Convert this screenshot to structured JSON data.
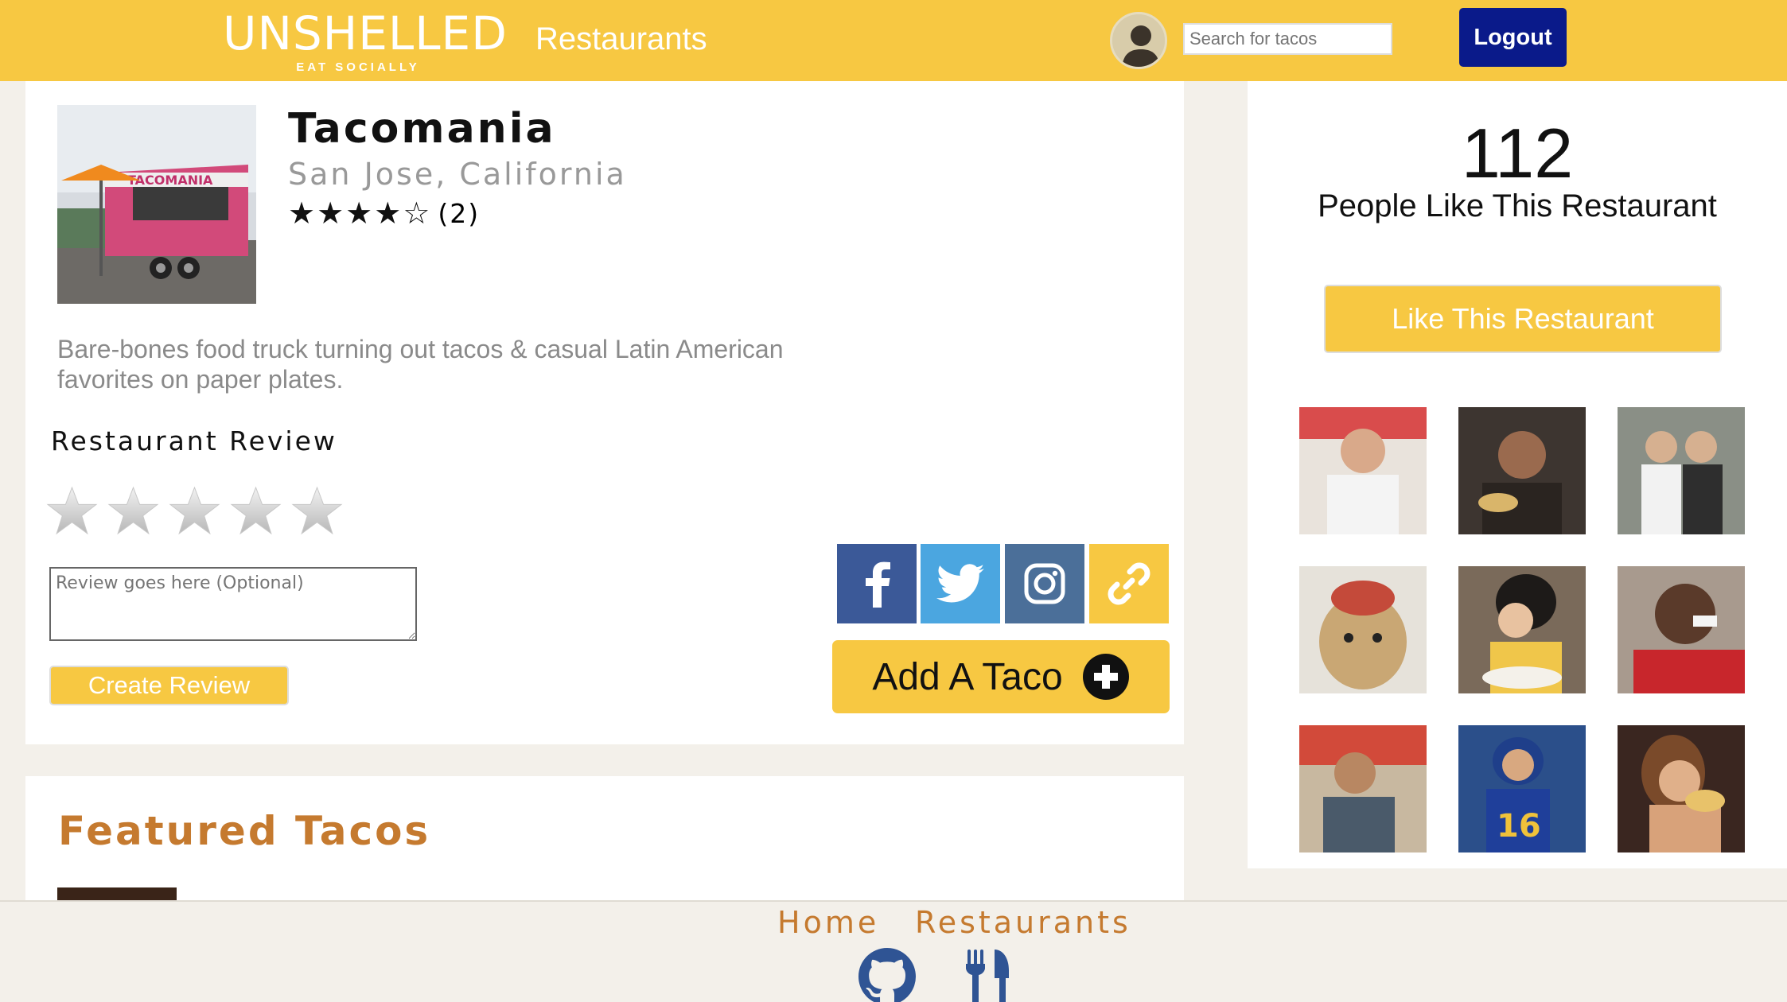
{
  "header": {
    "logo": "UNSHELLED",
    "tagline": "EAT SOCIALLY",
    "nav_restaurants": "Restaurants",
    "search_placeholder": "Search for tacos",
    "logout_label": "Logout"
  },
  "restaurant": {
    "name": "Tacomania",
    "location": "San Jose, California",
    "rating": 4,
    "rating_max": 5,
    "review_count": "(2)",
    "description": "Bare-bones food truck turning out tacos & casual Latin American favorites on paper plates."
  },
  "review_form": {
    "title": "Restaurant Review",
    "placeholder": "Review goes here (Optional)",
    "submit_label": "Create Review"
  },
  "actions": {
    "add_taco_label": "Add A Taco",
    "share": [
      "facebook-icon",
      "twitter-icon",
      "instagram-icon",
      "link-icon"
    ]
  },
  "featured": {
    "title": "Featured Tacos"
  },
  "likes": {
    "count": "112",
    "label": "People Like This Restaurant",
    "like_button": "Like This Restaurant"
  },
  "footer": {
    "home": "Home",
    "restaurants": "Restaurants"
  },
  "colors": {
    "brand_yellow": "#f7c842",
    "logout_blue": "#0a1a8a",
    "accent_orange": "#c57a2f",
    "footer_icon_blue": "#2f5494"
  }
}
